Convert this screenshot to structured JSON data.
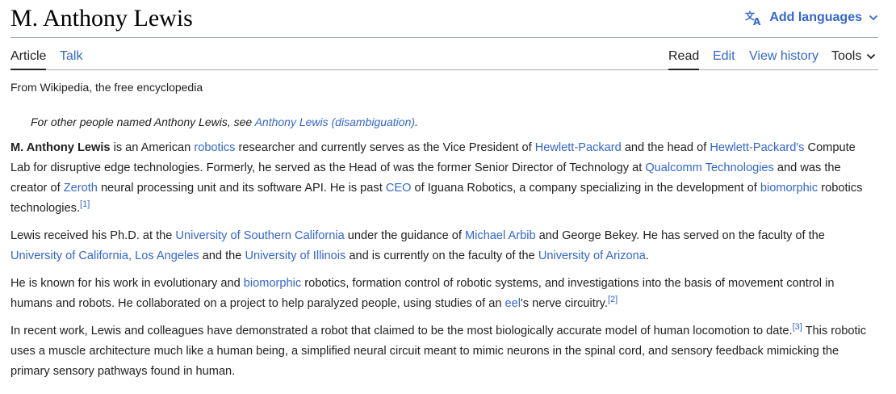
{
  "title": "M. Anthony Lewis",
  "languages_label": "Add languages",
  "tabs": {
    "article": "Article",
    "talk": "Talk",
    "read": "Read",
    "edit": "Edit",
    "view_history": "View history",
    "tools": "Tools"
  },
  "tagline": "From Wikipedia, the free encyclopedia",
  "hatnote": {
    "prefix": "For other people named Anthony Lewis, see ",
    "link": "Anthony Lewis (disambiguation)",
    "suffix": "."
  },
  "p1": {
    "bold": "M. Anthony Lewis",
    "t1": " is an American ",
    "l1": "robotics",
    "t2": " researcher and currently serves as the Vice President of ",
    "l2": "Hewlett-Packard",
    "t3": " and the head of ",
    "l3": "Hewlett-Packard's",
    "t4": " Compute Lab for disruptive edge technologies. Formerly, he served as the Head of was the former Senior Director of Technology at ",
    "l4": "Qualcomm Technologies",
    "t5": " and was the creator of ",
    "l5": "Zeroth",
    "t6": " neural processing unit and its software API. He is past ",
    "l6": "CEO",
    "t7": " of Iguana Robotics, a company specializing in the development of ",
    "l7": "biomorphic",
    "t8": " robotics technologies.",
    "ref": "[1]"
  },
  "p2": {
    "t1": "Lewis received his Ph.D. at the ",
    "l1": "University of Southern California",
    "t2": " under the guidance of ",
    "l2": "Michael Arbib",
    "t3": " and George Bekey. He has served on the faculty of the ",
    "l3": "University of California, Los Angeles",
    "t4": " and the ",
    "l4": "University of Illinois",
    "t5": " and is currently on the faculty of the ",
    "l5": "University of Arizona",
    "t6": "."
  },
  "p3": {
    "t1": "He is known for his work in evolutionary and ",
    "l1": "biomorphic",
    "t2": " robotics, formation control of robotic systems, and investigations into the basis of movement control in humans and robots. He collaborated on a project to help paralyzed people, using studies of an ",
    "l2": "eel",
    "t3": "'s nerve circuitry.",
    "ref": "[2]"
  },
  "p4": {
    "t1": "In recent work, Lewis and colleagues have demonstrated a robot that claimed to be the most biologically accurate model of human locomotion to date.",
    "ref": "[3]",
    "t2": " This robotic uses a muscle architecture much like a human being, a simplified neural circuit meant to mimic neurons in the spinal cord, and sensory feedback mimicking the primary sensory pathways found in human."
  },
  "icons": {
    "languages": "translate-icon",
    "dropdown": "chevron-down-icon"
  },
  "colors": {
    "link": "#3366cc",
    "text": "#202122",
    "border": "#a2a9b1"
  }
}
